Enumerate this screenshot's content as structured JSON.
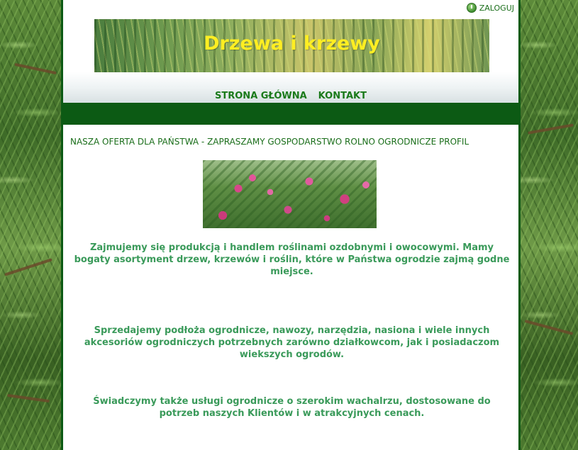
{
  "header": {
    "login_label": "ZALOGUJ",
    "banner_title": "Drzewa i krzewy"
  },
  "nav": {
    "items": [
      "STRONA GŁÓWNA",
      "KONTAKT"
    ]
  },
  "content": {
    "intro": "NASZA OFERTA DLA PAŃSTWA - ZAPRASZAMY GOSPODARSTWO ROLNO OGRODNICZE PROFIL",
    "paragraphs": [
      "Zajmujemy się produkcją i handlem roślinami ozdobnymi i owocowymi. Mamy bogaty asortyment drzew, krzewów i roślin, które w Państwa ogrodzie zajmą godne miejsce.",
      "Sprzedajemy podłoża ogrodnicze, nawozy, narzędzia, nasiona i wiele innych akcesoriów ogrodniczych potrzebnych zarówno działkowcom, jak i posiadaczom wiekszych ogrodów.",
      "Świadczymy także usługi ogrodnicze o szerokim wachalrzu, dostosowane do potrzeb naszych Klientów i w atrakcyjnych cenach."
    ]
  },
  "colors": {
    "accent_dark_green": "#0c5a14",
    "nav_text": "#1a7a1a",
    "paragraph_text": "#3a9a5a",
    "banner_title": "#ffee22"
  },
  "icons": {
    "login": "power-icon"
  }
}
